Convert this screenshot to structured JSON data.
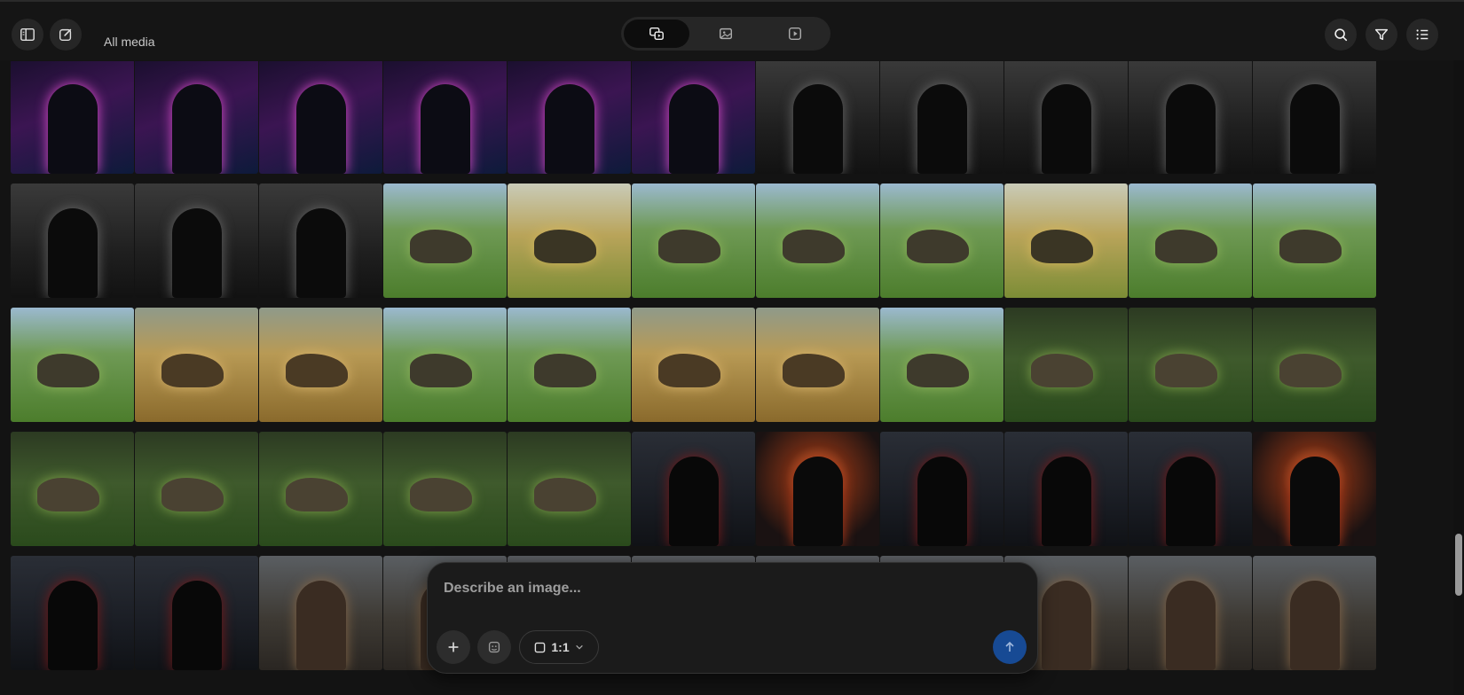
{
  "header": {
    "breadcrumb": "All media"
  },
  "icons": {
    "sidebar": "sidebar-toggle-icon",
    "new": "edit-icon",
    "all": "media-all-icon",
    "images": "image-icon",
    "videos": "video-icon",
    "search": "search-icon",
    "filter": "filter-icon",
    "list": "list-icon"
  },
  "composer": {
    "placeholder": "Describe an image...",
    "aspect_ratio": "1:1"
  },
  "colors": {
    "accent": "#174a94",
    "background": "#131313"
  },
  "gallery": {
    "rows": [
      [
        "cyberpunk",
        "cyberpunk",
        "cyberpunk",
        "cyberpunk",
        "cyberpunk",
        "cyberpunk",
        "noir",
        "noir",
        "noir",
        "noir",
        "noir"
      ],
      [
        "noir",
        "noir",
        "noir",
        "raptor",
        "raptor-sun",
        "raptor",
        "raptor",
        "raptor",
        "raptor-sun",
        "raptor",
        "raptor"
      ],
      [
        "raptor",
        "savanna",
        "savanna",
        "raptor",
        "raptor",
        "savanna",
        "savanna",
        "raptor",
        "jungle",
        "jungle",
        "jungle"
      ],
      [
        "jungle",
        "jungle",
        "jungle",
        "jungle",
        "jungle",
        "vampire",
        "vampire-fire",
        "vampire",
        "vampire",
        "vampire",
        "vampire-fire"
      ],
      [
        "vampire",
        "vampire",
        "viking",
        "viking",
        "viking",
        "viking",
        "viking",
        "viking",
        "viking",
        "viking",
        "viking"
      ]
    ]
  }
}
